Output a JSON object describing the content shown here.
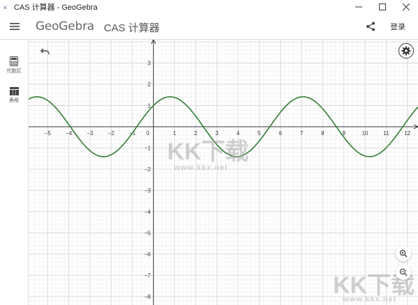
{
  "window": {
    "title": "CAS 计算器 - GeoGebra",
    "icon": "geogebra-app-icon",
    "controls": [
      "minimize-icon",
      "maximize-icon",
      "close-icon"
    ]
  },
  "header": {
    "brand": "GeoGebra",
    "app_title": "CAS 计算器",
    "login_label": "登录",
    "menu_icon": "hamburger-menu-icon",
    "share_icon": "share-icon"
  },
  "sidebar": {
    "items": [
      {
        "label": "代数区",
        "icon": "calculator-icon"
      },
      {
        "label": "表格",
        "icon": "table-icon"
      }
    ]
  },
  "graph": {
    "x_ticks": [
      -5,
      -4,
      -3,
      -2,
      -1,
      0,
      1,
      2,
      3,
      4,
      5,
      6,
      7,
      8,
      9,
      10,
      11,
      12
    ],
    "y_ticks": [
      3,
      2,
      1,
      -1,
      -2,
      -3,
      -4,
      -5,
      -6,
      -7,
      -8
    ],
    "x_range": [
      -5.9,
      12.5
    ],
    "y_range": [
      -8.4,
      4.1
    ],
    "curve_color": "#2e7d32",
    "grid_minor_color": "#ececec",
    "grid_major_color": "#cfcfcf",
    "curve_visible": {
      "y_min": -1.41,
      "y_max": 1.41
    }
  },
  "tools": {
    "undo_icon": "undo-icon",
    "settings_icon": "gear-icon",
    "zoom_in_icon": "zoom-in-icon",
    "zoom_out_icon": "zoom-out-icon"
  },
  "watermark": {
    "logo": "KK下载",
    "url": "www.kkx.net"
  }
}
